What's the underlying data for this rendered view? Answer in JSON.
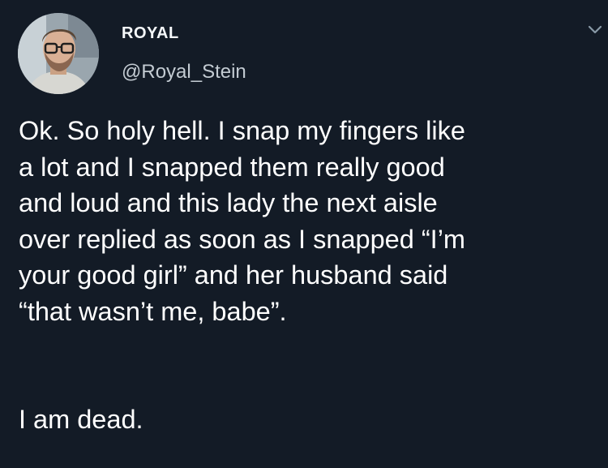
{
  "tweet": {
    "display_name": "ROYAL",
    "handle": "@Royal_Stein",
    "text_lines": [
      "Ok. So holy hell. I snap my fingers like",
      "a lot and I snapped them really good",
      "and loud and this lady the next aisle",
      "over replied as soon as I snapped “I’m",
      "your good girl” and her husband said",
      "“that wasn’t me, babe”."
    ],
    "closing_line": "I am dead.",
    "menu_icon": "chevron-down-icon"
  },
  "colors": {
    "background": "#131b26",
    "name": "#f5f8fa",
    "handle": "#c3cbd2",
    "text": "#ffffff"
  }
}
